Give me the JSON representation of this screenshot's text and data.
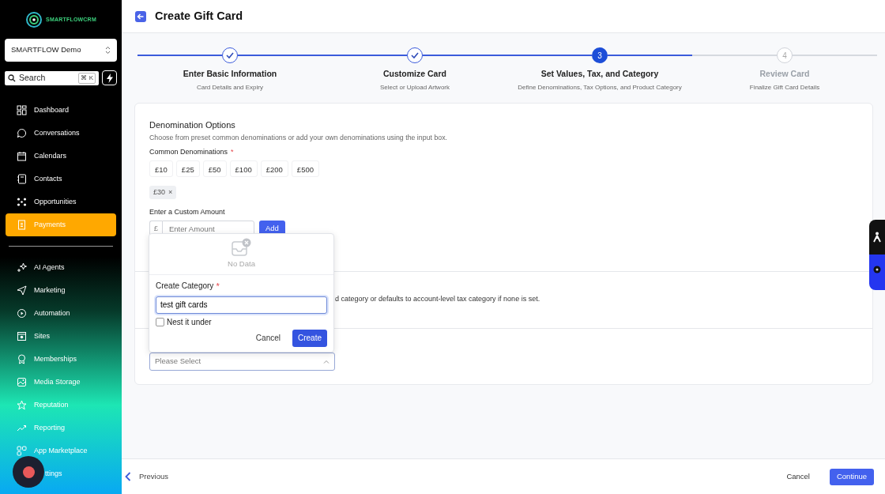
{
  "sidebar": {
    "brand": "SMARTFLOWCRM",
    "account": "SMARTFLOW Demo",
    "search": {
      "label": "Search",
      "shortcut": "⌘ K"
    },
    "nav": [
      {
        "label": "Dashboard",
        "selected": false
      },
      {
        "label": "Conversations",
        "selected": false
      },
      {
        "label": "Calendars",
        "selected": false
      },
      {
        "label": "Contacts",
        "selected": false
      },
      {
        "label": "Opportunities",
        "selected": false
      },
      {
        "label": "Payments",
        "selected": true
      }
    ],
    "nav2": [
      {
        "label": "AI Agents",
        "selected": false
      },
      {
        "label": "Marketing",
        "selected": false
      },
      {
        "label": "Automation",
        "selected": false
      },
      {
        "label": "Sites",
        "selected": false
      },
      {
        "label": "Memberships",
        "selected": false
      },
      {
        "label": "Media Storage",
        "selected": false
      },
      {
        "label": "Reputation",
        "selected": false
      },
      {
        "label": "Reporting",
        "selected": false
      },
      {
        "label": "App Marketplace",
        "selected": false
      },
      {
        "label": "ttings",
        "selected": false
      }
    ]
  },
  "header": {
    "title": "Create Gift Card"
  },
  "steps": [
    {
      "title": "Enter Basic Information",
      "subtitle": "Card Details and Expiry",
      "done": true,
      "current": false
    },
    {
      "title": "Customize Card",
      "subtitle": "Select or Upload Artwork",
      "done": true,
      "current": false
    },
    {
      "number": "3",
      "title": "Set Values, Tax, and Category",
      "subtitle": "Define Denominations, Tax Options, and Product Category",
      "done": false,
      "current": true
    },
    {
      "number": "4",
      "title": "Review Card",
      "subtitle": "Finalize Gift Card Details",
      "done": false,
      "current": false
    }
  ],
  "denominations": {
    "title": "Denomination Options",
    "description": "Choose from preset common denominations or add your own denominations using the input box.",
    "label": "Common Denominations",
    "required_mark": "*",
    "presets": [
      {
        "label": "£10",
        "selected": false
      },
      {
        "label": "£25",
        "selected": false
      },
      {
        "label": "£50",
        "selected": false
      },
      {
        "label": "£100",
        "selected": false
      },
      {
        "label": "£200",
        "selected": false
      },
      {
        "label": "£500",
        "selected": false
      }
    ],
    "tags": [
      {
        "label": "£30",
        "remove": "×"
      }
    ],
    "custom": {
      "label": "Enter a Custom Amount",
      "prefix": "£",
      "placeholder": "Enter Amount",
      "button": "Add"
    }
  },
  "tax": {
    "description": "d category or defaults to account-level tax category if none is set."
  },
  "category": {
    "placeholder": "Please Select",
    "expanded": true
  },
  "popup": {
    "empty_text": "No Data",
    "label": "Create Category",
    "required_mark": "*",
    "value": "test gift cards",
    "nest": {
      "label": "Nest it under",
      "checked": false
    },
    "cancel": "Cancel",
    "create": "Create"
  },
  "footer": {
    "previous": "Previous",
    "cancel": "Cancel",
    "continue": "Continue"
  }
}
